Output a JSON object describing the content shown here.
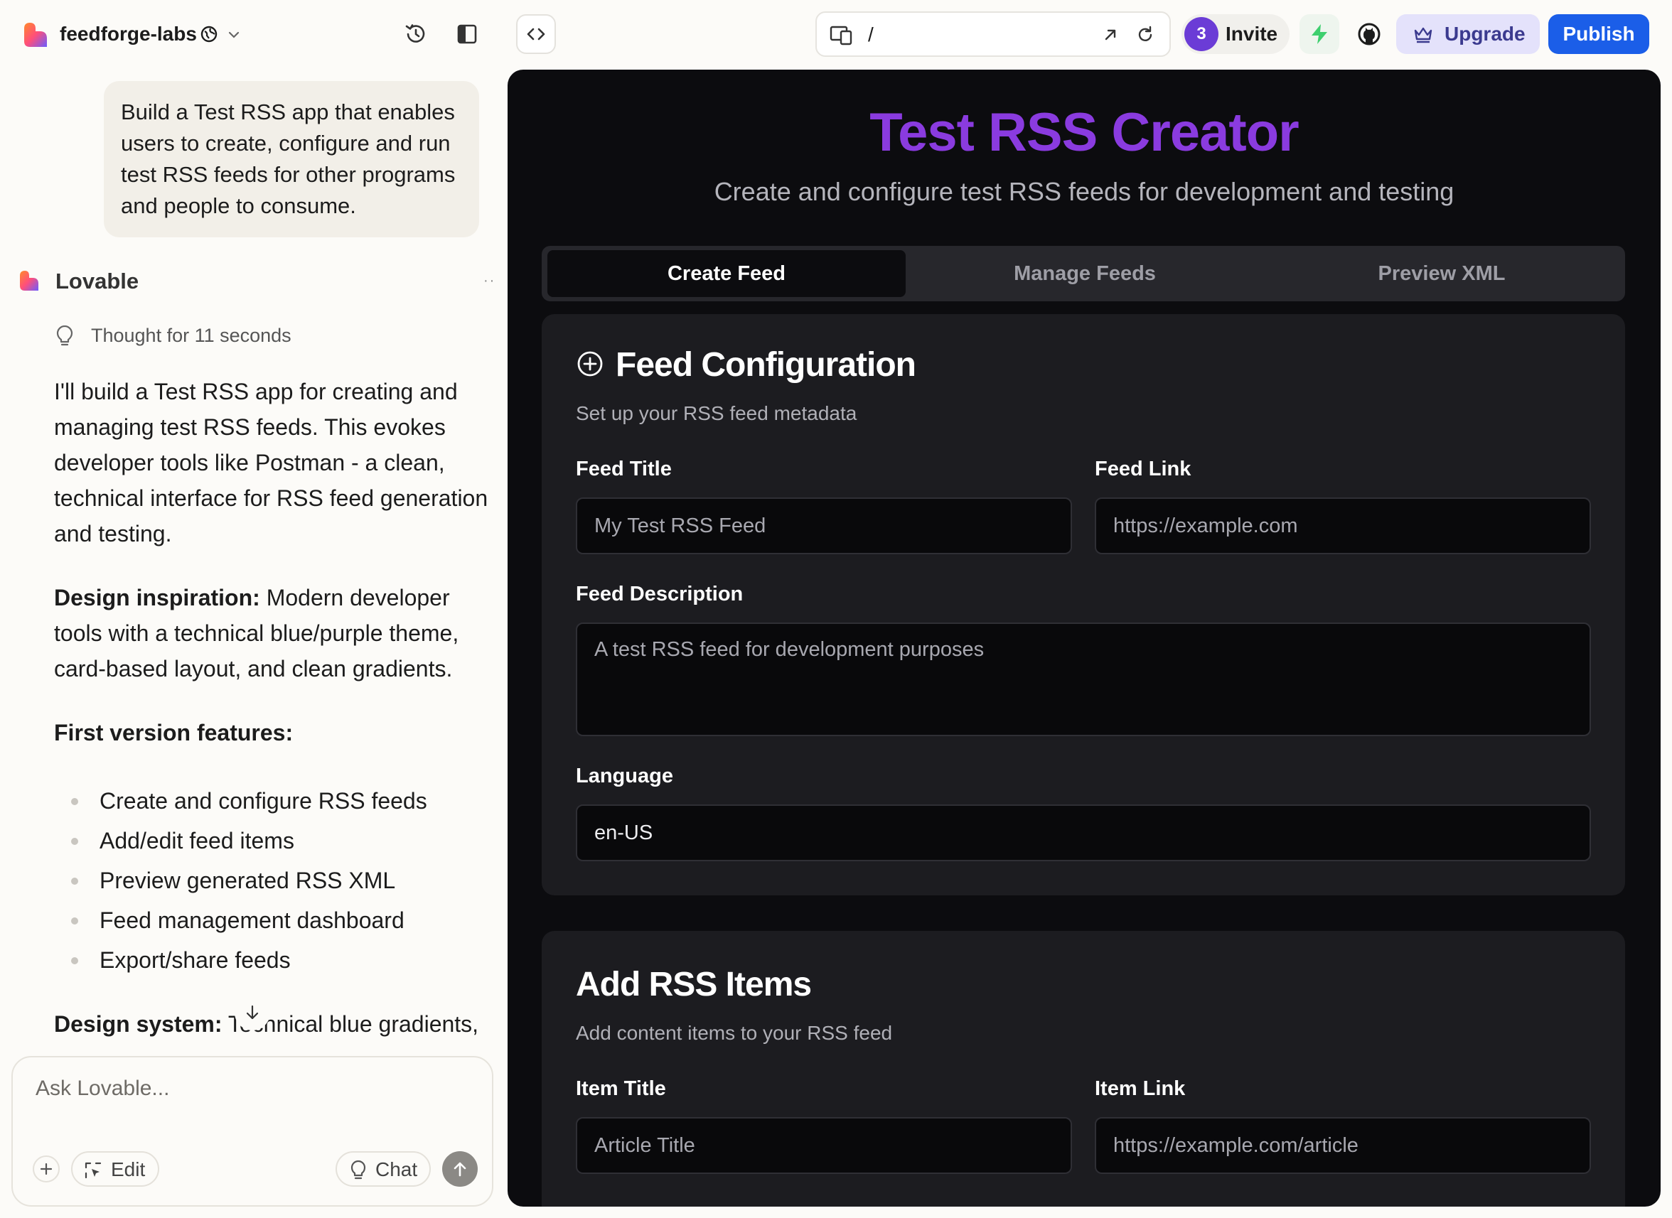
{
  "topbar": {
    "project_name": "feedforge-labs",
    "url_path": "/",
    "invite_count": "3",
    "invite_label": "Invite",
    "upgrade_label": "Upgrade",
    "publish_label": "Publish",
    "colors": {
      "publish": "#1b5ee8",
      "upgrade_bg": "#e4e2fb",
      "avatar": "#6b3cd6"
    }
  },
  "chat": {
    "user_message": "Build a Test RSS app that enables users to create, configure and run test RSS feeds for other programs and people to consume.",
    "assistant_name": "Lovable",
    "thought_label": "Thought for 11 seconds",
    "intro": "I'll build a Test RSS app for creating and managing test RSS feeds. This evokes developer tools like Postman - a clean, technical interface for RSS feed generation and testing.",
    "design_label": "Design inspiration:",
    "design_text": " Modern developer tools with a technical blue/purple theme, card-based layout, and clean gradients.",
    "features_label": "First version features:",
    "features": [
      "Create and configure RSS feeds",
      "Add/edit feed items",
      "Preview generated RSS XML",
      "Feed management dashboard",
      "Export/share feeds"
    ],
    "system_label": "Design system:",
    "system_text": " Technical blue gradients,",
    "composer": {
      "placeholder": "Ask Lovable...",
      "edit_label": "Edit",
      "chat_label": "Chat"
    }
  },
  "preview": {
    "title": "Test RSS Creator",
    "subtitle": "Create and configure test RSS feeds for development and testing",
    "title_color": "#8a3bdf",
    "tabs": [
      {
        "label": "Create Feed",
        "active": true
      },
      {
        "label": "Manage Feeds",
        "active": false
      },
      {
        "label": "Preview XML",
        "active": false
      }
    ],
    "feed_config": {
      "heading": "Feed Configuration",
      "subheading": "Set up your RSS feed metadata",
      "title_label": "Feed Title",
      "title_placeholder": "My Test RSS Feed",
      "link_label": "Feed Link",
      "link_placeholder": "https://example.com",
      "description_label": "Feed Description",
      "description_placeholder": "A test RSS feed for development purposes",
      "language_label": "Language",
      "language_value": "en-US"
    },
    "items": {
      "heading": "Add RSS Items",
      "subheading": "Add content items to your RSS feed",
      "item_title_label": "Item Title",
      "item_title_placeholder": "Article Title",
      "item_link_label": "Item Link",
      "item_link_placeholder": "https://example.com/article"
    }
  }
}
